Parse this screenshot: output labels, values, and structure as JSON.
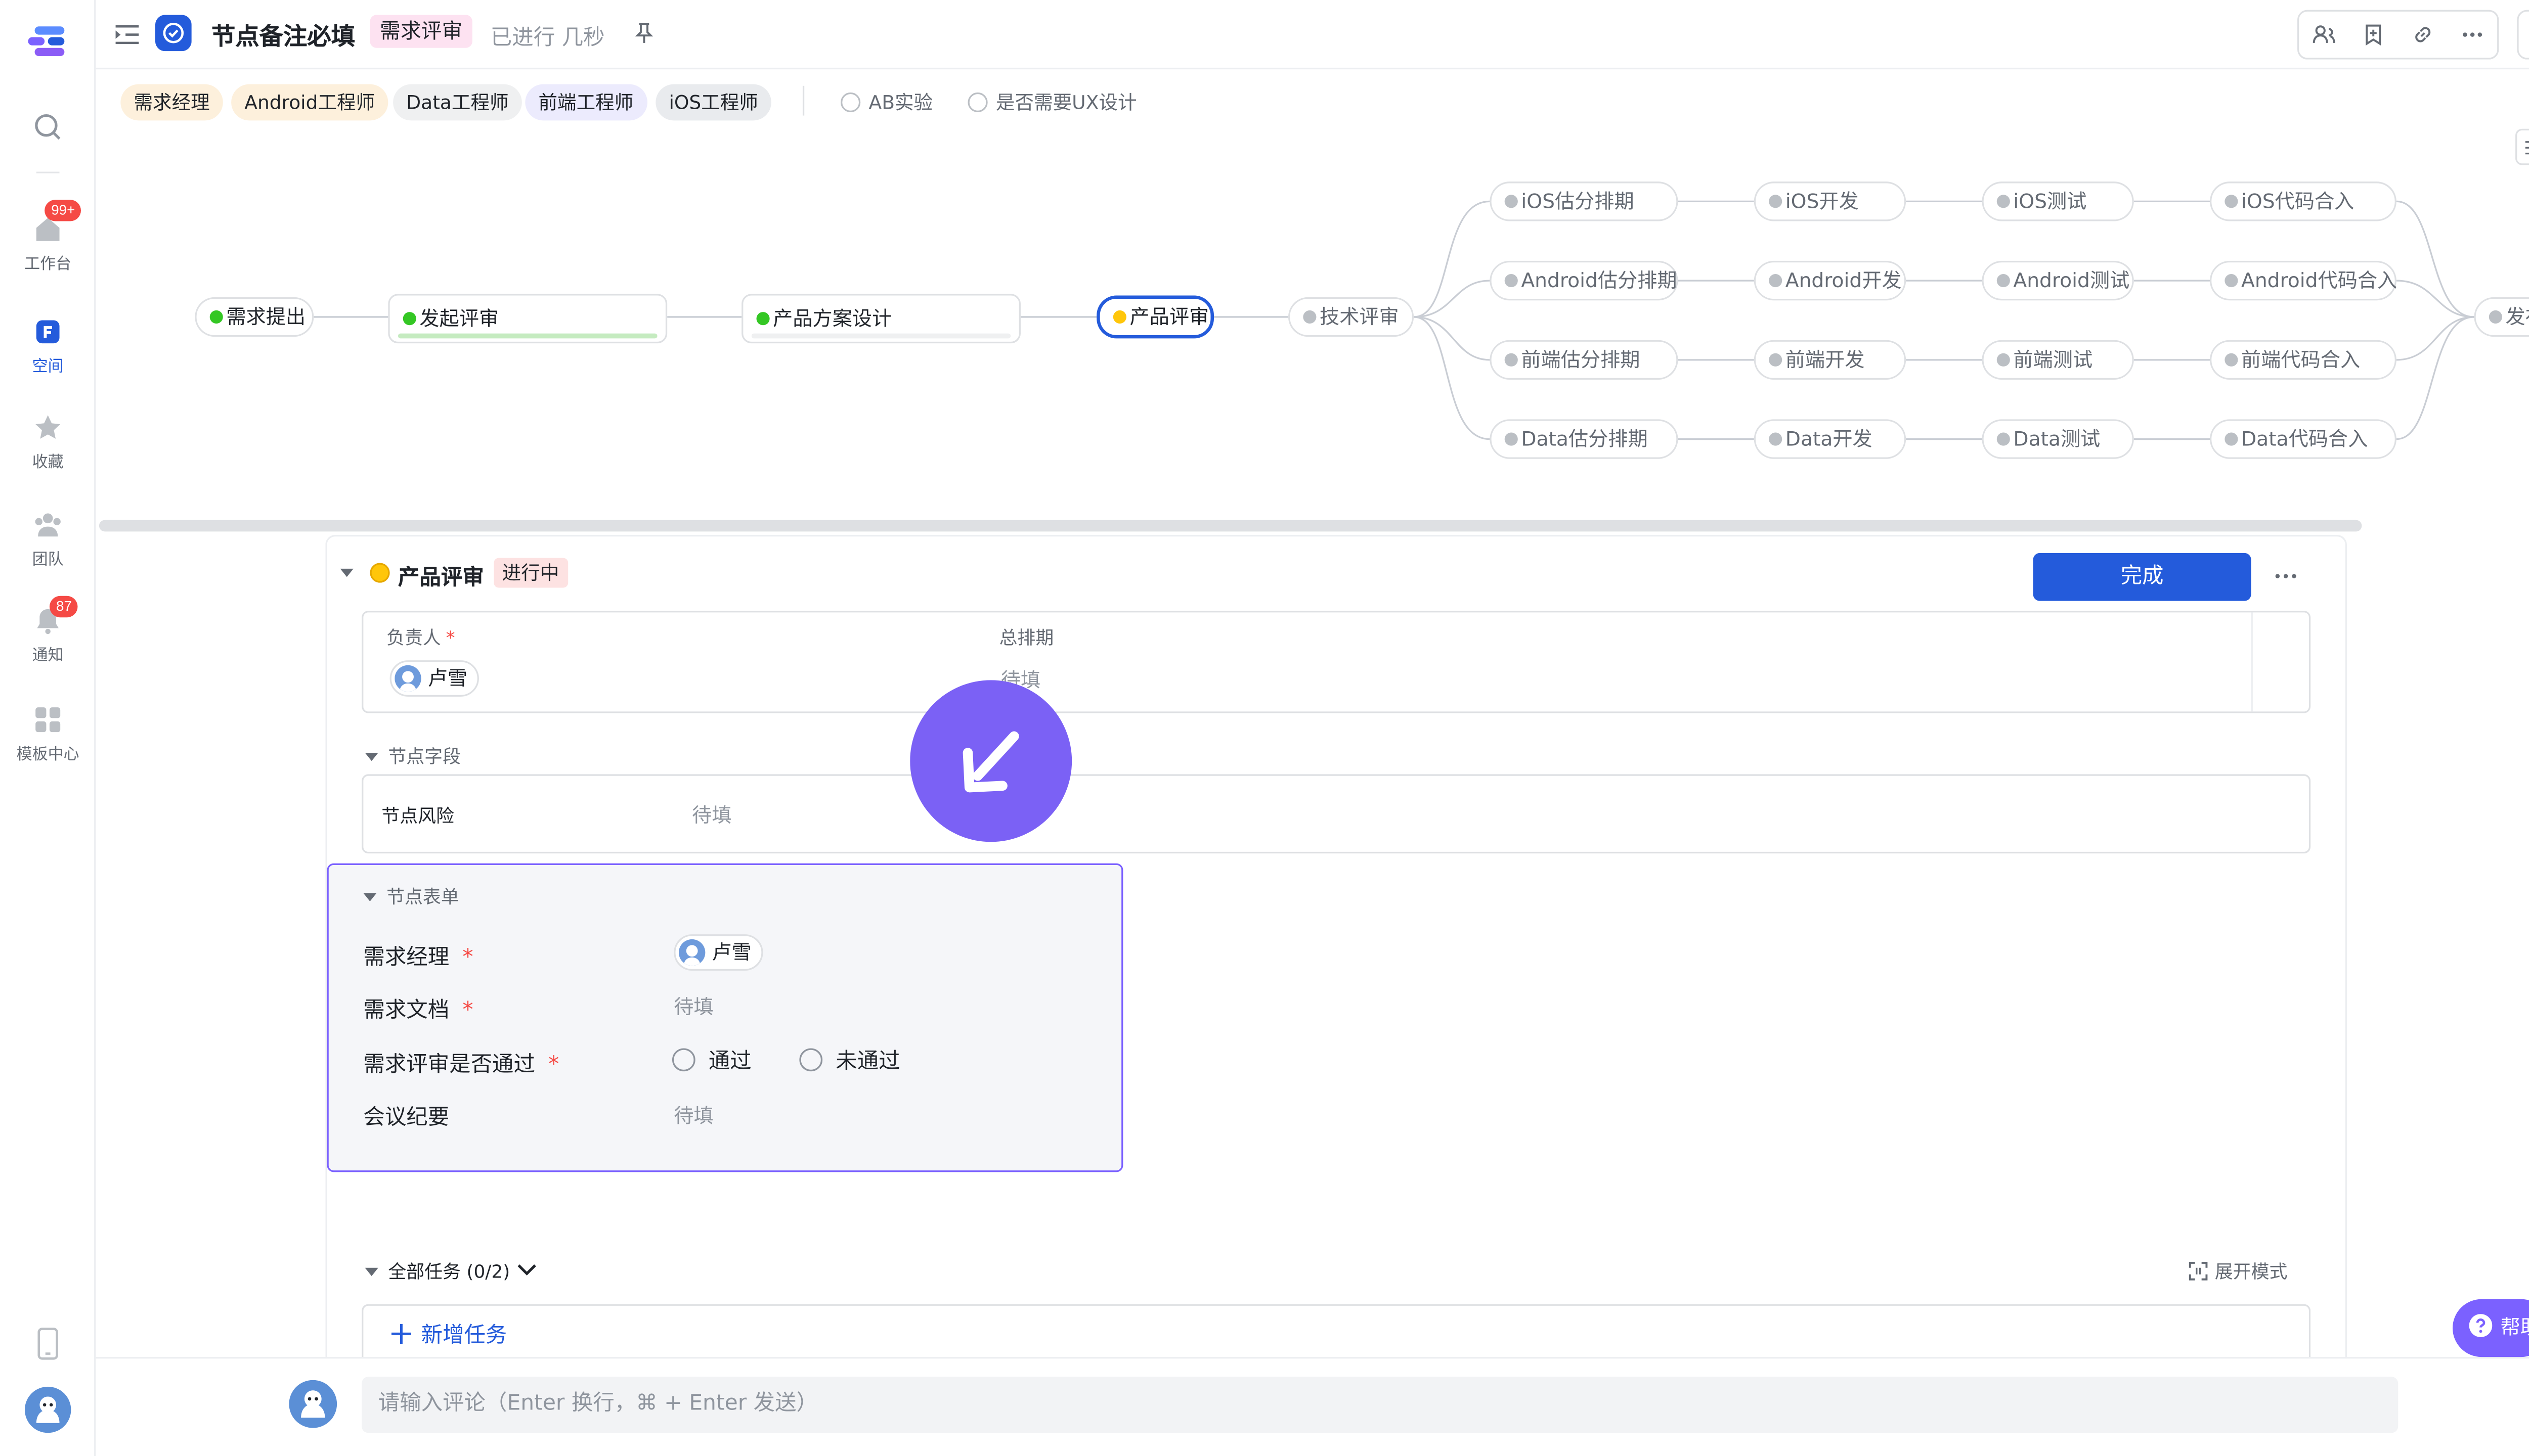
{
  "rail": {
    "workbench": "工作台",
    "workbench_badge": "99+",
    "space": "空间",
    "favorites": "收藏",
    "team": "团队",
    "notify": "通知",
    "notify_badge": "87",
    "templates": "模板中心"
  },
  "header": {
    "title": "节点备注必填",
    "status_tag": "需求评审",
    "elapsed": "已进行 几秒"
  },
  "roles": [
    "需求经理",
    "Android工程师",
    "Data工程师",
    "前端工程师",
    "iOS工程师"
  ],
  "options": [
    "AB实验",
    "是否需要UX设计"
  ],
  "flow": {
    "main": [
      "需求提出",
      "发起评审",
      "产品方案设计",
      "产品评审",
      "技术评审"
    ],
    "rows": [
      [
        "iOS估分排期",
        "iOS开发",
        "iOS测试",
        "iOS代码合入"
      ],
      [
        "Android估分排期",
        "Android开发",
        "Android测试",
        "Android代码合入"
      ],
      [
        "前端估分排期",
        "前端开发",
        "前端测试",
        "前端代码合入"
      ],
      [
        "Data估分排期",
        "Data开发",
        "Data测试",
        "Data代码合入"
      ]
    ],
    "end": "发布"
  },
  "detail": {
    "title": "产品评审",
    "status": "进行中",
    "complete_btn": "完成",
    "owner_label": "负责人",
    "owner": "卢雪",
    "schedule_label": "总排期",
    "schedule_value": "待填",
    "fields_section": "节点字段",
    "risk_label": "节点风险",
    "risk_value": "待填",
    "form_section": "节点表单",
    "form": {
      "pm_label": "需求经理",
      "pm_value": "卢雪",
      "doc_label": "需求文档",
      "doc_value": "待填",
      "pass_label": "需求评审是否通过",
      "pass_yes": "通过",
      "pass_no": "未通过",
      "minutes_label": "会议纪要",
      "minutes_value": "待填"
    },
    "tasks_label": "全部任务 (0/2)",
    "expand_mode": "展开模式",
    "add_task": "新增任务"
  },
  "comment": {
    "placeholder": "请输入评论（Enter 换行，⌘ + Enter 发送）"
  },
  "help": "帮助",
  "colors": {
    "accent": "#245bdb",
    "form_border": "#7b61ff",
    "badge": "#f54a45",
    "cursor": "#7b61f5"
  }
}
